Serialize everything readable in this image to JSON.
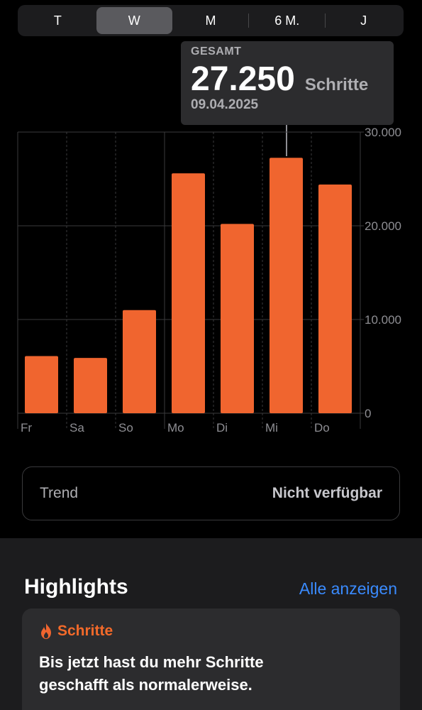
{
  "segments": [
    {
      "label": "T",
      "active": false
    },
    {
      "label": "W",
      "active": true
    },
    {
      "label": "M",
      "active": false
    },
    {
      "label": "6 M.",
      "active": false
    },
    {
      "label": "J",
      "active": false
    }
  ],
  "tooltip": {
    "label": "GESAMT",
    "value": "27.250",
    "unit": "Schritte",
    "date": "09.04.2025"
  },
  "chart_data": {
    "type": "bar",
    "categories": [
      "Fr",
      "Sa",
      "So",
      "Mo",
      "Di",
      "Mi",
      "Do"
    ],
    "values": [
      6100,
      5900,
      11000,
      25600,
      20200,
      27250,
      24400
    ],
    "ylim": [
      0,
      30000
    ],
    "y_ticks": [
      {
        "value": 0,
        "label": "0"
      },
      {
        "value": 10000,
        "label": "10.000"
      },
      {
        "value": 20000,
        "label": "20.000"
      },
      {
        "value": 30000,
        "label": "30.000"
      }
    ],
    "highlighted_index": 5,
    "bar_color": "#f0652f",
    "grid": true
  },
  "trend": {
    "label": "Trend",
    "value": "Nicht verfügbar"
  },
  "highlights": {
    "title": "Highlights",
    "link": "Alle anzeigen",
    "card": {
      "category": "Schritte",
      "icon": "flame-icon",
      "text": "Bis jetzt hast du mehr Schritte geschafft als normalerweise."
    }
  },
  "colors": {
    "accent": "#f0652f",
    "link": "#3a8bff",
    "background": "#000000",
    "panel": "#1c1c1e"
  }
}
